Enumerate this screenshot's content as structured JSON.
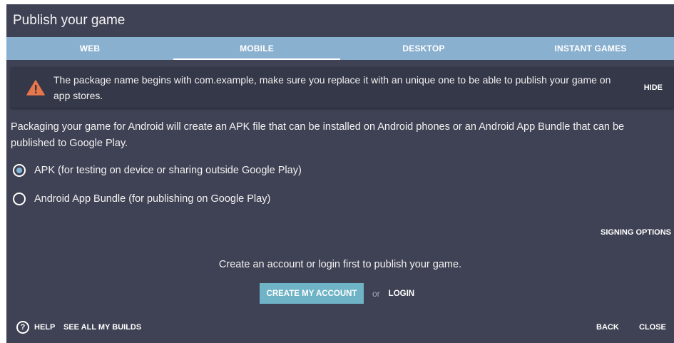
{
  "dialog": {
    "title": "Publish your game"
  },
  "tabs": [
    {
      "label": "WEB",
      "active": false
    },
    {
      "label": "MOBILE",
      "active": true
    },
    {
      "label": "DESKTOP",
      "active": false
    },
    {
      "label": "INSTANT GAMES",
      "active": false
    }
  ],
  "alert": {
    "icon": "warning-icon",
    "message": "The package name begins with com.example, make sure you replace it with an unique one to be able to publish your game on app stores.",
    "hide_label": "HIDE"
  },
  "description": "Packaging your game for Android will create an APK file that can be installed on Android phones or an Android App Bundle that can be published to Google Play.",
  "options": [
    {
      "label": "APK (for testing on device or sharing outside Google Play)",
      "checked": true
    },
    {
      "label": "Android App Bundle (for publishing on Google Play)",
      "checked": false
    }
  ],
  "signing_options_label": "SIGNING OPTIONS",
  "account": {
    "prompt": "Create an account or login first to publish your game.",
    "create_label": "CREATE MY ACCOUNT",
    "or_label": "or",
    "login_label": "LOGIN"
  },
  "footer": {
    "help_icon": "help-circle-icon",
    "help_label": "HELP",
    "builds_label": "SEE ALL MY BUILDS",
    "back_label": "BACK",
    "close_label": "CLOSE"
  },
  "colors": {
    "dialog_bg": "#3f4254",
    "tab_bar": "#8ab0cf",
    "alert_bg": "#353849",
    "warning": "#e8764a",
    "primary_button": "#6fb3c6"
  }
}
